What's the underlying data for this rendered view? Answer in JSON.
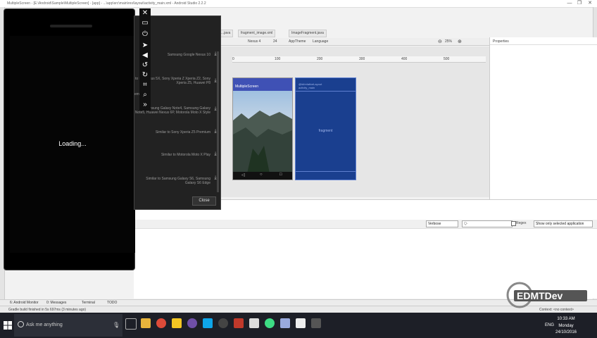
{
  "window": {
    "title": "MultipleScreen - [E:\\Android\\Sample\\MultipleScreen] - [app] - ...\\app\\src\\main\\res\\layout\\activity_main.xml - Android Studio 2.2.2"
  },
  "editor_tabs": [
    {
      "label": "...java"
    },
    {
      "label": "fragment_image.xml"
    },
    {
      "label": "ImageFragment.java"
    }
  ],
  "design_toolbar": {
    "device": "Nexus 4",
    "api": "24",
    "theme": "AppTheme",
    "language": "Language",
    "zoom": "25%"
  },
  "ruler_ticks": [
    "0",
    "100",
    "200",
    "300",
    "400",
    "500"
  ],
  "properties": {
    "title": "Properties"
  },
  "preview": {
    "app_title": "MultipleScreen",
    "blueprint_id_line1": "@id/relativeLayout",
    "blueprint_id_line2": "activity_main",
    "blueprint_label": "fragment"
  },
  "emulator": {
    "loading_text": "Loading..."
  },
  "device_chooser": {
    "rows": [
      {
        "text": "Samsung Google Nexus 10"
      },
      {
        "text": "to LG Nexus 5X, Sony Xperia Z Xperia Z2, Sony Xperia Z5, Huawei P8"
      },
      {
        "text": "emulator..."
      },
      {
        "text": "to Samsung Galaxy Note4, Samsung Galaxy Note5, Huawei Nexus 6P, Motorola Moto X Style"
      },
      {
        "text": "Similar to Sony Xperia Z5 Premium"
      },
      {
        "text": "Similar to Motorola Moto X Play"
      },
      {
        "text": "Similar to Samsung Galaxy S6, Samsung Galaxy S6 Edge"
      }
    ],
    "close_label": "Close"
  },
  "logcat": {
    "level": "Verbose",
    "search_placeholder": "Q-",
    "regex_label": "Regex",
    "filter": "Show only selected application"
  },
  "bottom_tabs": [
    {
      "label": "6: Android Monitor"
    },
    {
      "label": "0: Messages"
    },
    {
      "label": "Terminal"
    },
    {
      "label": "TODO"
    }
  ],
  "status_text": "Gradle build finished in 5s 697ms (3 minutes ago)",
  "status_right": "Context: <no context>",
  "taskbar": {
    "search_placeholder": "Ask me anything",
    "lang": "ENG",
    "time": "10:33 AM",
    "day": "Monday",
    "date": "24/10/2016"
  },
  "watermark": {
    "text": "EDMTDev"
  },
  "colors": {
    "accent": "#3f51b5",
    "blueprint": "#1a3f8f",
    "taskbar": "#1d1f27"
  }
}
